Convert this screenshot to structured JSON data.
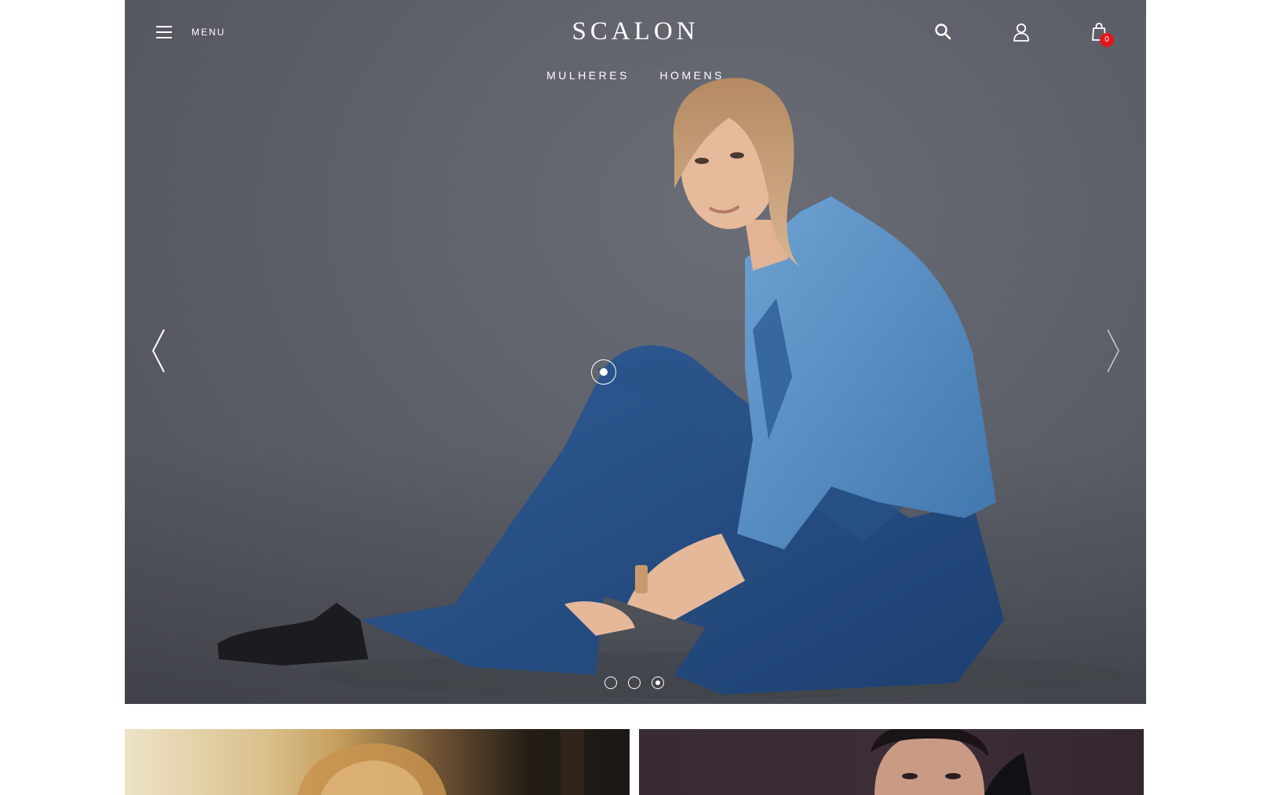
{
  "header": {
    "menu_label": "MENU",
    "logo": "SCALON",
    "cart_count": "0",
    "icons": [
      "hamburger-icon",
      "search-icon",
      "user-icon",
      "shopping-bag-icon"
    ]
  },
  "nav": {
    "items": [
      {
        "label": "MULHERES"
      },
      {
        "label": "HOMENS"
      }
    ]
  },
  "hero": {
    "background": "#5d6069",
    "slide_count": 3,
    "active_slide": 3
  },
  "tiles": [
    {
      "name": "women-tile"
    },
    {
      "name": "men-tile"
    }
  ],
  "colors": {
    "badge": "#e4141b",
    "text_on_hero": "#ffffff",
    "denim": "#2f5c95"
  }
}
